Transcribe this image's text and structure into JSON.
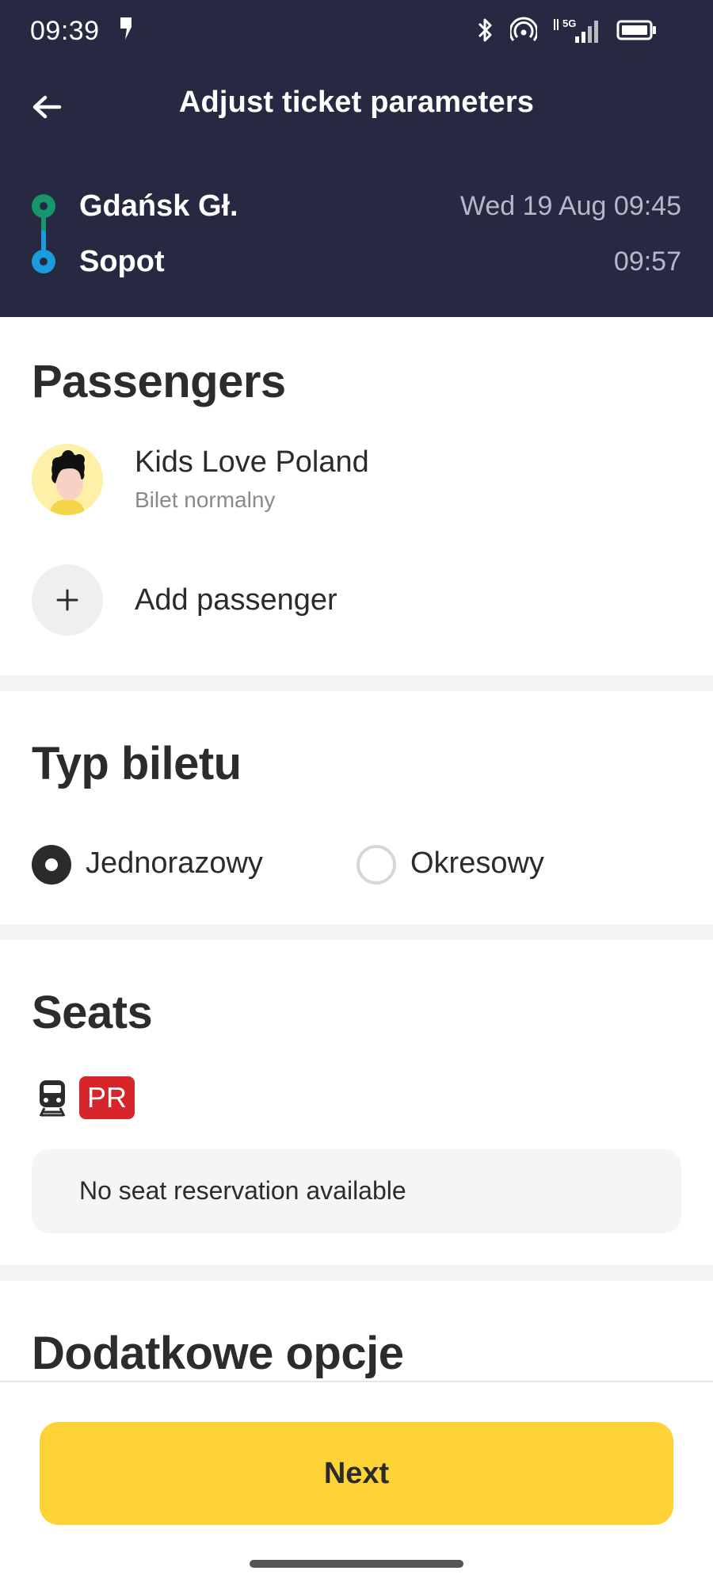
{
  "status_bar": {
    "time": "09:39",
    "network_label": "5G"
  },
  "header": {
    "title": "Adjust ticket parameters",
    "route": {
      "from_station": "Gdańsk Gł.",
      "from_time": "Wed 19 Aug 09:45",
      "to_station": "Sopot",
      "to_time": "09:57"
    },
    "colors": {
      "background": "#272841",
      "from_dot": "#17956b",
      "to_dot": "#1a9bdc"
    }
  },
  "passengers": {
    "heading": "Passengers",
    "items": [
      {
        "name": "Kids Love Poland",
        "ticket": "Bilet normalny",
        "avatar_icon": "person-avatar-icon"
      }
    ],
    "add_label": "Add passenger"
  },
  "ticket_type": {
    "heading": "Typ biletu",
    "options": [
      {
        "label": "Jednorazowy",
        "selected": true
      },
      {
        "label": "Okresowy",
        "selected": false
      }
    ]
  },
  "seats": {
    "heading": "Seats",
    "carrier_badge": "PR",
    "carrier_color": "#d7262a",
    "info": "No seat reservation available"
  },
  "extras": {
    "heading": "Dodatkowe opcje"
  },
  "footer": {
    "next_label": "Next",
    "next_color": "#fdd335"
  }
}
